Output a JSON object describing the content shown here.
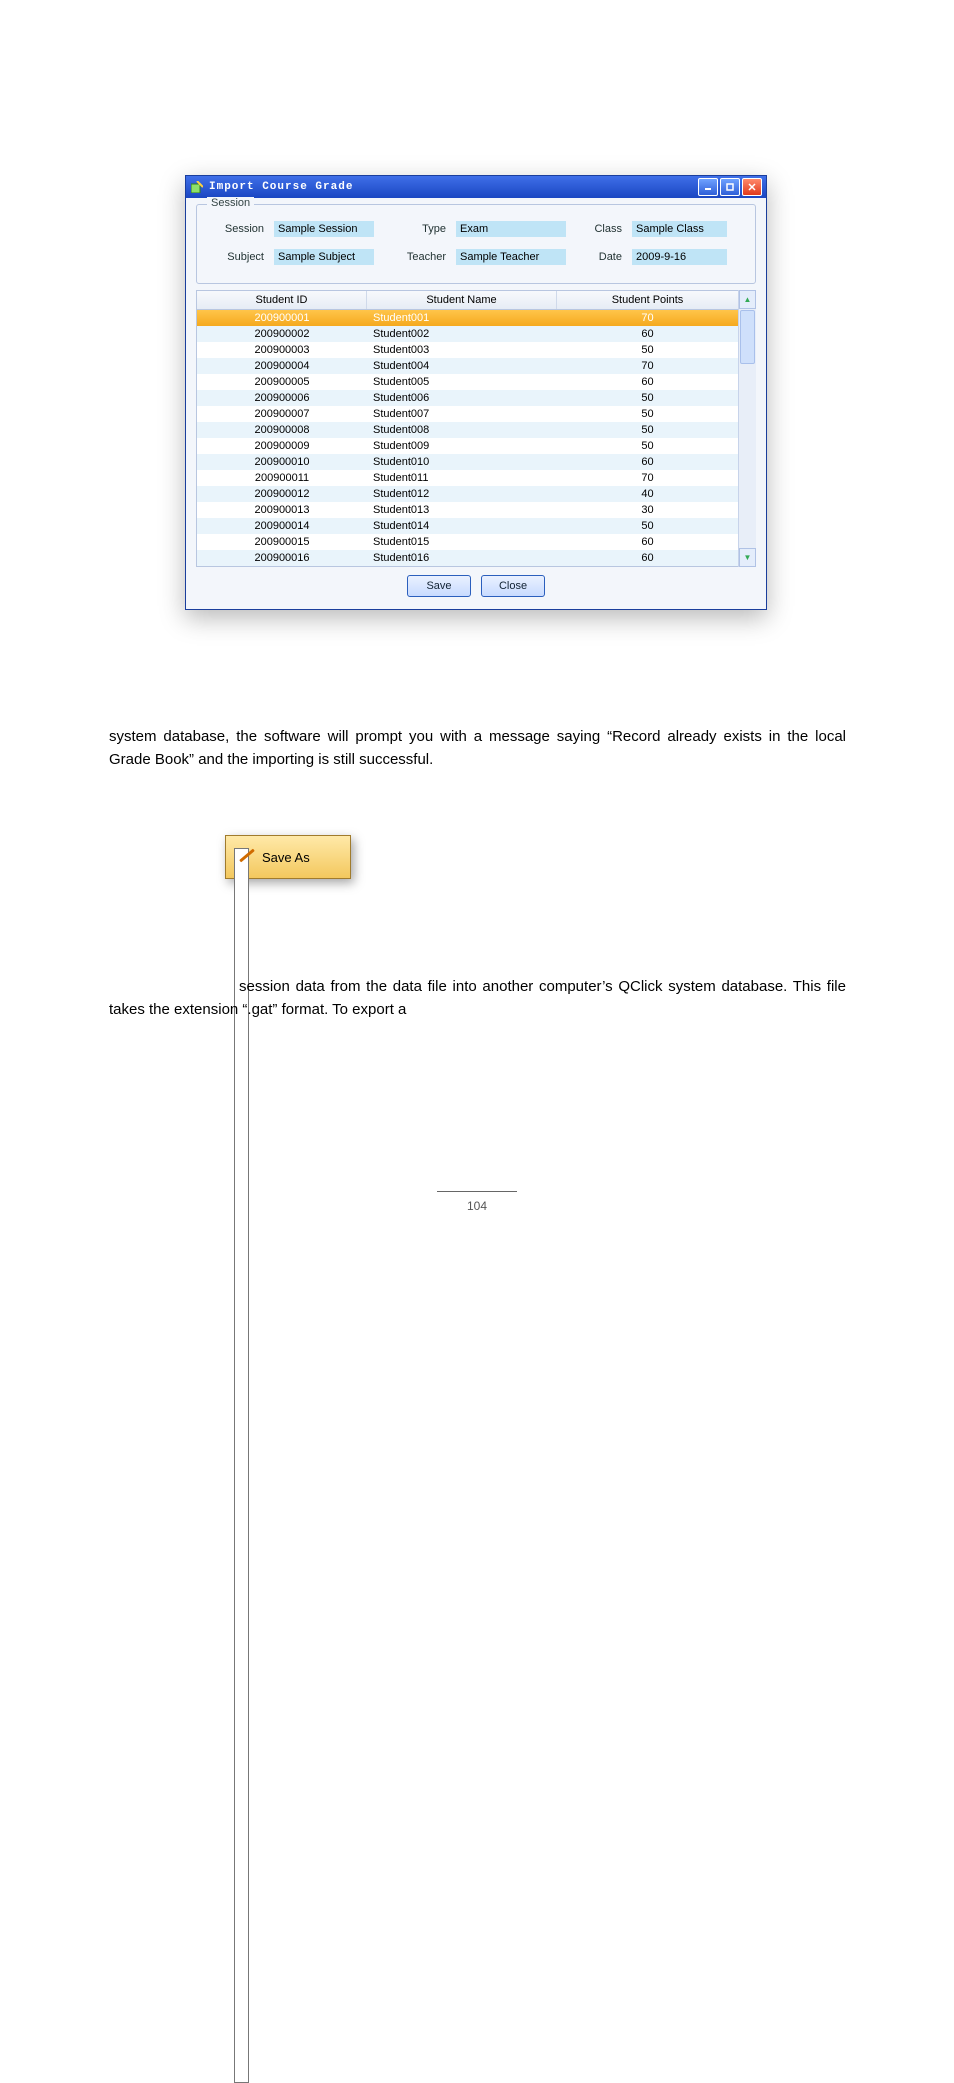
{
  "window": {
    "title": "Import Course Grade",
    "session_group_legend": "Session",
    "labels": {
      "session": "Session",
      "type": "Type",
      "class": "Class",
      "subject": "Subject",
      "teacher": "Teacher",
      "date": "Date"
    },
    "values": {
      "session": "Sample Session",
      "type": "Exam",
      "class": "Sample Class",
      "subject": "Sample Subject",
      "teacher": "Sample Teacher",
      "date": "2009-9-16"
    },
    "columns": {
      "id": "Student ID",
      "name": "Student Name",
      "points": "Student Points"
    },
    "rows": [
      {
        "id": "200900001",
        "name": "Student001",
        "points": "70",
        "selected": true
      },
      {
        "id": "200900002",
        "name": "Student002",
        "points": "60"
      },
      {
        "id": "200900003",
        "name": "Student003",
        "points": "50"
      },
      {
        "id": "200900004",
        "name": "Student004",
        "points": "70"
      },
      {
        "id": "200900005",
        "name": "Student005",
        "points": "60"
      },
      {
        "id": "200900006",
        "name": "Student006",
        "points": "50"
      },
      {
        "id": "200900007",
        "name": "Student007",
        "points": "50"
      },
      {
        "id": "200900008",
        "name": "Student008",
        "points": "50"
      },
      {
        "id": "200900009",
        "name": "Student009",
        "points": "50"
      },
      {
        "id": "200900010",
        "name": "Student010",
        "points": "60"
      },
      {
        "id": "200900011",
        "name": "Student011",
        "points": "70"
      },
      {
        "id": "200900012",
        "name": "Student012",
        "points": "40"
      },
      {
        "id": "200900013",
        "name": "Student013",
        "points": "30"
      },
      {
        "id": "200900014",
        "name": "Student014",
        "points": "50"
      },
      {
        "id": "200900015",
        "name": "Student015",
        "points": "60"
      },
      {
        "id": "200900016",
        "name": "Student016",
        "points": "60"
      }
    ],
    "buttons": {
      "save": "Save",
      "close": "Close"
    }
  },
  "text": {
    "para1": "system database, the software will prompt you with a message saying “Record already exists in the local Grade Book” and the importing is still successful.",
    "saveas_label": "Save As",
    "para2": "session data from the data file into another computer’s QClick system database. This file takes the extension “.gat” format. To export a"
  },
  "footer": {
    "page": "104"
  }
}
